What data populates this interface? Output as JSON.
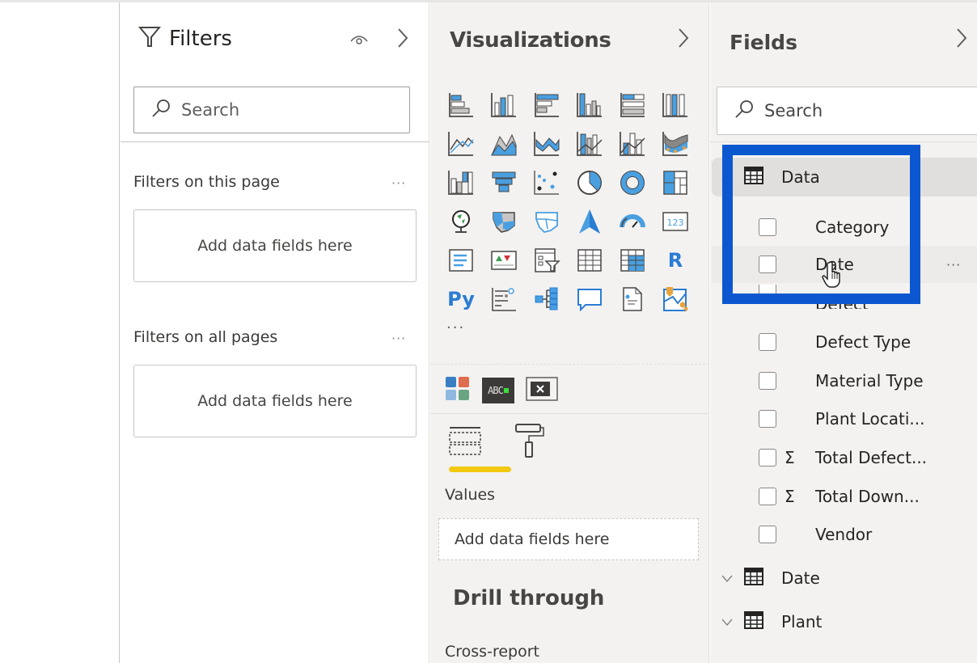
{
  "filters": {
    "title": "Filters",
    "search_placeholder": "Search",
    "this_page_label": "Filters on this page",
    "this_page_drop": "Add data fields here",
    "all_pages_label": "Filters on all pages",
    "all_pages_drop": "Add data fields here",
    "ellipsis": "···"
  },
  "visualizations": {
    "title": "Visualizations",
    "more": "···",
    "icons": [
      "stacked-bar-chart-icon",
      "stacked-column-chart-icon",
      "clustered-bar-chart-icon",
      "clustered-column-chart-icon",
      "100-stacked-bar-chart-icon",
      "100-stacked-column-chart-icon",
      "line-chart-icon",
      "area-chart-icon",
      "stacked-area-chart-icon",
      "line-clustered-column-chart-icon",
      "line-stacked-column-chart-icon",
      "ribbon-chart-icon",
      "waterfall-chart-icon",
      "funnel-chart-icon",
      "scatter-chart-icon",
      "pie-chart-icon",
      "donut-chart-icon",
      "treemap-icon",
      "map-icon",
      "filled-map-icon",
      "shape-map-icon",
      "azure-map-icon",
      "gauge-icon",
      "card-icon",
      "multi-row-card-icon",
      "kpi-icon",
      "slicer-icon",
      "table-icon",
      "matrix-icon",
      "r-visual-icon",
      "python-visual-icon",
      "key-influencers-icon",
      "decomposition-tree-icon",
      "qa-icon",
      "paginated-report-icon",
      "arcgis-map-icon"
    ],
    "custom_icons": [
      "chiclet-slicer-icon",
      "text-scroller-icon",
      "close-visual-icon"
    ],
    "custom_text": "ABC",
    "values_label": "Values",
    "values_drop": "Add data fields here",
    "drill_through": "Drill through",
    "cross_report": "Cross-report",
    "r_label": "R",
    "py_label": "Py",
    "card_label": "123"
  },
  "fields": {
    "title": "Fields",
    "search_placeholder": "Search",
    "tables": [
      {
        "name": "Data",
        "expanded": true,
        "fields": [
          {
            "name": "Category",
            "sigma": false
          },
          {
            "name": "Date",
            "sigma": false,
            "hover": true
          },
          {
            "name": "Defect",
            "sigma": false
          },
          {
            "name": "Defect Type",
            "sigma": false
          },
          {
            "name": "Material Type",
            "sigma": false
          },
          {
            "name": "Plant Locati...",
            "sigma": false
          },
          {
            "name": "Total Defect...",
            "sigma": true
          },
          {
            "name": "Total Down...",
            "sigma": true
          },
          {
            "name": "Vendor",
            "sigma": false
          }
        ]
      },
      {
        "name": "Date",
        "expanded": false
      },
      {
        "name": "Plant",
        "expanded": false
      }
    ],
    "sigma": "Σ",
    "more": "···"
  },
  "colors": {
    "highlight": "#0b57d0",
    "accent_yellow": "#f2c811",
    "viz_blue": "#4a9fe0"
  }
}
